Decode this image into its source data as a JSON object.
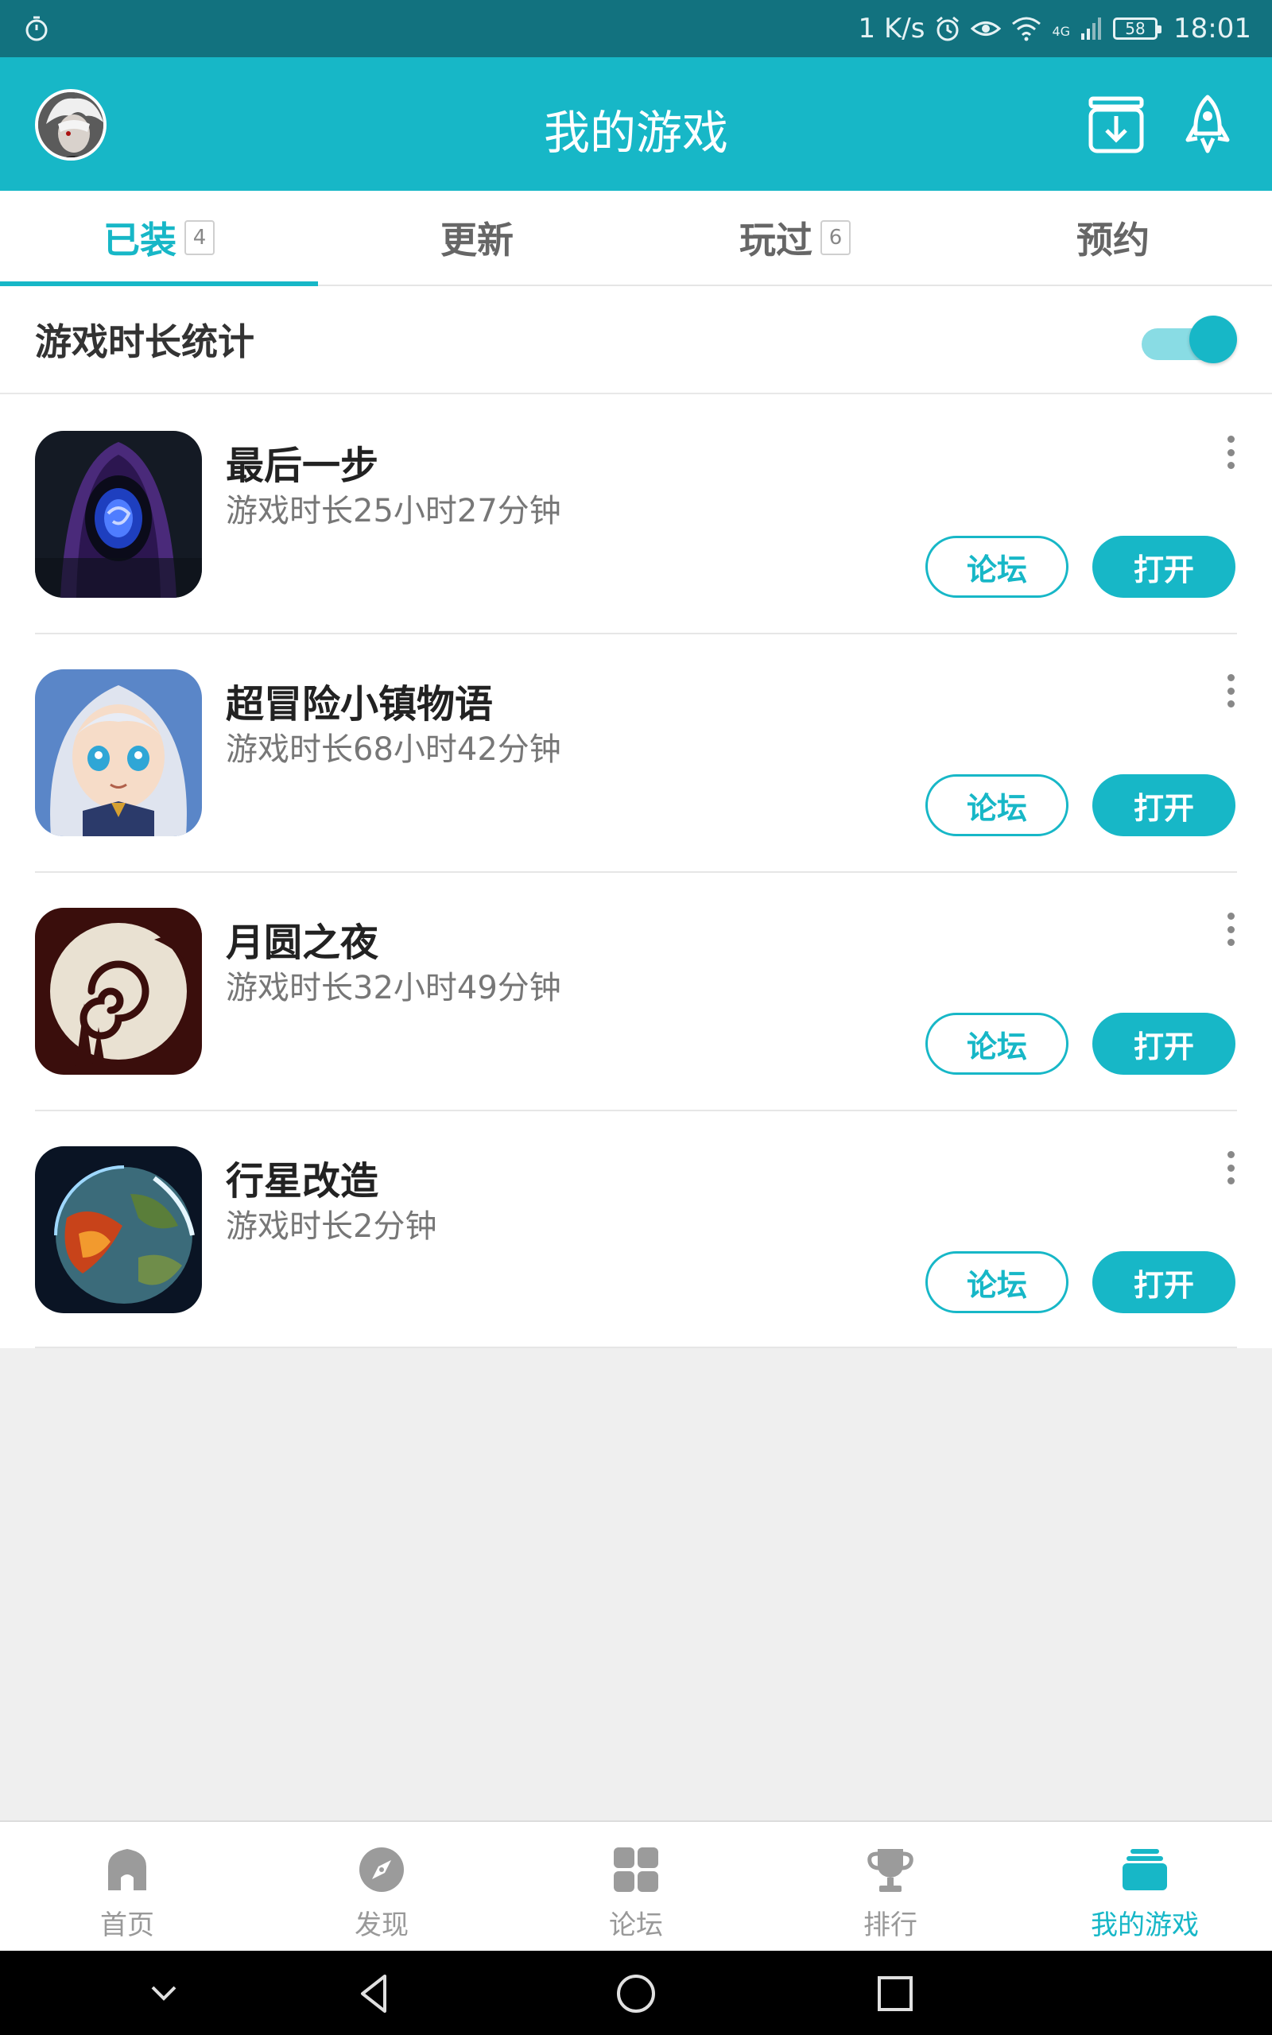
{
  "status_bar": {
    "speed": "1 K/s",
    "network": "4G",
    "battery": "58",
    "time": "18:01"
  },
  "header": {
    "title": "我的游戏"
  },
  "tabs": [
    {
      "label": "已装",
      "badge": "4"
    },
    {
      "label": "更新",
      "badge": ""
    },
    {
      "label": "玩过",
      "badge": "6"
    },
    {
      "label": "预约",
      "badge": ""
    }
  ],
  "stats": {
    "label": "游戏时长统计",
    "enabled": true
  },
  "games": [
    {
      "name": "最后一步",
      "playtime": "游戏时长25小时27分钟",
      "forum_label": "论坛",
      "open_label": "打开"
    },
    {
      "name": "超冒险小镇物语",
      "playtime": "游戏时长68小时42分钟",
      "forum_label": "论坛",
      "open_label": "打开"
    },
    {
      "name": "月圆之夜",
      "playtime": "游戏时长32小时49分钟",
      "forum_label": "论坛",
      "open_label": "打开"
    },
    {
      "name": "行星改造",
      "playtime": "游戏时长2分钟",
      "forum_label": "论坛",
      "open_label": "打开"
    }
  ],
  "bottom_nav": [
    {
      "label": "首页",
      "icon": "home-icon"
    },
    {
      "label": "发现",
      "icon": "compass-icon"
    },
    {
      "label": "论坛",
      "icon": "grid-icon"
    },
    {
      "label": "排行",
      "icon": "trophy-icon"
    },
    {
      "label": "我的游戏",
      "icon": "stack-icon",
      "active": true
    }
  ],
  "colors": {
    "accent": "#17b7c7",
    "status_bar": "#12727f"
  }
}
